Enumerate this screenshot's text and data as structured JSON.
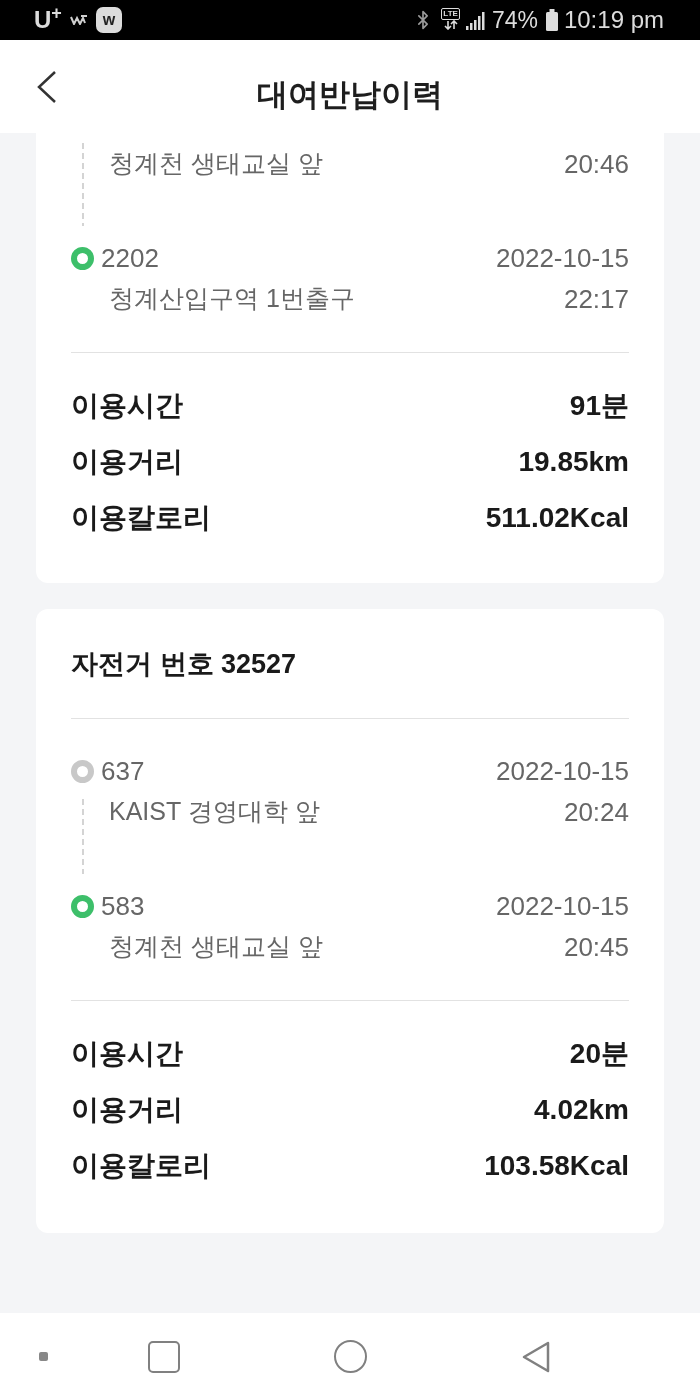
{
  "status_bar": {
    "carrier": "U$^{+}$",
    "notification_badge": "w",
    "network": "LTE",
    "battery": "74%",
    "time": "10:19 pm"
  },
  "header": {
    "title": "대여반납이력"
  },
  "rentals": [
    {
      "stops": [
        {
          "name": "청계천 생태교실 앞",
          "time": "20:46"
        },
        {
          "kind": "return",
          "station": "2202",
          "date": "2022-10-15",
          "name": "청계산입구역 1번출구",
          "time": "22:17"
        }
      ],
      "stats": [
        {
          "label": "이용시간",
          "value": "91분"
        },
        {
          "label": "이용거리",
          "value": "19.85km"
        },
        {
          "label": "이용칼로리",
          "value": "511.02Kcal"
        }
      ]
    },
    {
      "bike": "자전거 번호 32527",
      "stops": [
        {
          "kind": "rent",
          "station": "637",
          "date": "2022-10-15",
          "name": "KAIST 경영대학 앞",
          "time": "20:24"
        },
        {
          "kind": "return",
          "station": "583",
          "date": "2022-10-15",
          "name": "청계천 생태교실 앞",
          "time": "20:45"
        }
      ],
      "stats": [
        {
          "label": "이용시간",
          "value": "20분"
        },
        {
          "label": "이용거리",
          "value": "4.02km"
        },
        {
          "label": "이용칼로리",
          "value": "103.58Kcal"
        }
      ]
    }
  ]
}
